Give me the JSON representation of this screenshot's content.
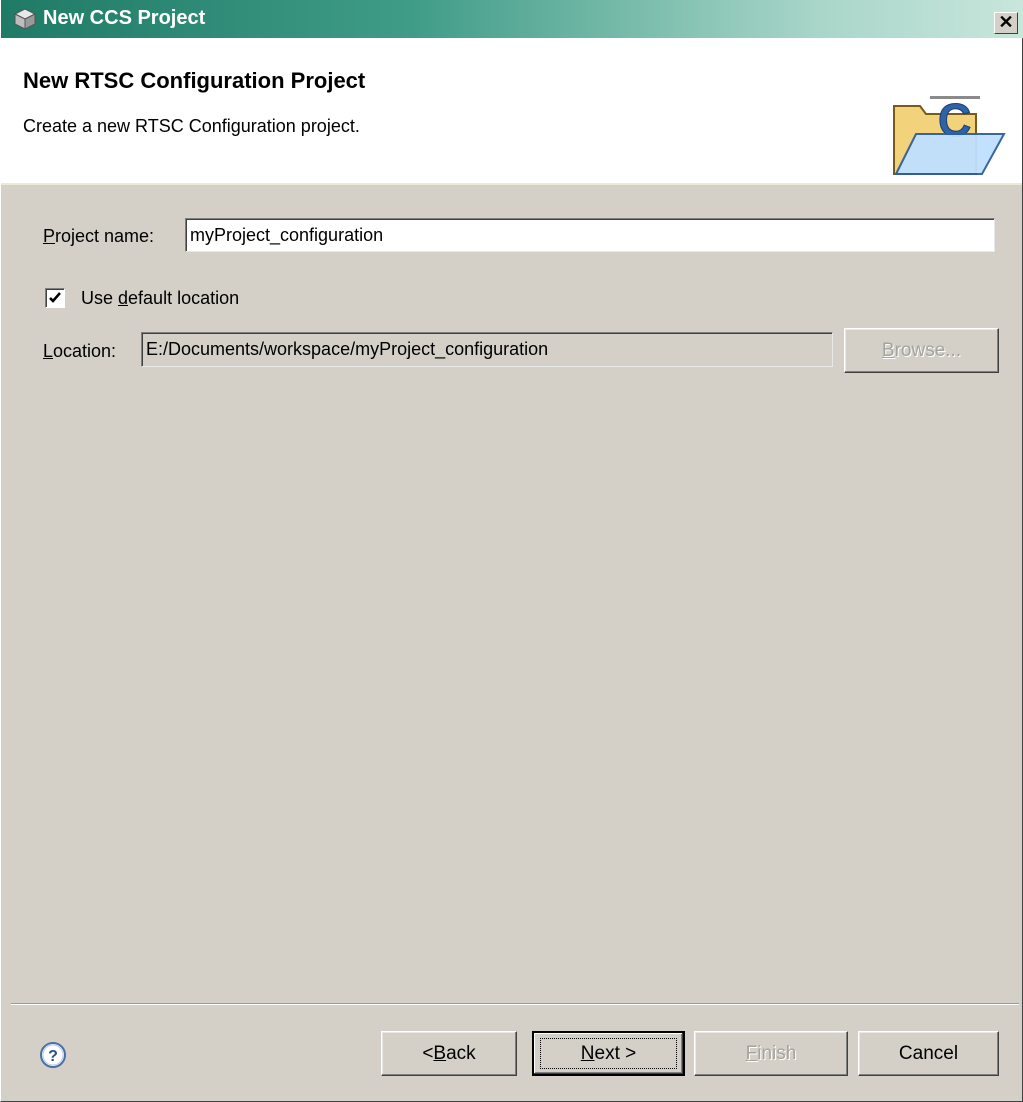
{
  "window": {
    "title": "New CCS Project",
    "close_label": "✕"
  },
  "banner": {
    "title": "New RTSC Configuration Project",
    "description": "Create a new RTSC Configuration project."
  },
  "form": {
    "project_name": {
      "label_mnemonic": "P",
      "label_rest": "roject name:",
      "value": "myProject_configuration"
    },
    "default_location": {
      "label_pre": "Use ",
      "label_mnemonic": "d",
      "label_rest": "efault location",
      "checked": true
    },
    "location": {
      "label_mnemonic": "L",
      "label_rest": "ocation:",
      "value": "E:/Documents/workspace/myProject_configuration"
    },
    "browse": {
      "label_mnemonic": "B",
      "label_rest": "rowse..."
    }
  },
  "footer": {
    "back": {
      "label_pre": "< ",
      "label_mnemonic": "B",
      "label_rest": "ack"
    },
    "next": {
      "label_mnemonic": "N",
      "label_rest": "ext >"
    },
    "finish": {
      "label_mnemonic": "F",
      "label_rest": "inish"
    },
    "cancel": {
      "label": "Cancel"
    }
  },
  "icons": {
    "title_icon": "cube-icon",
    "banner_icon": "folder-c-icon",
    "help_icon": "help-icon"
  },
  "colors": {
    "titlebar_start": "#1f7a66",
    "dialog_bg": "#d4d0c8",
    "banner_bg": "#ffffff"
  }
}
